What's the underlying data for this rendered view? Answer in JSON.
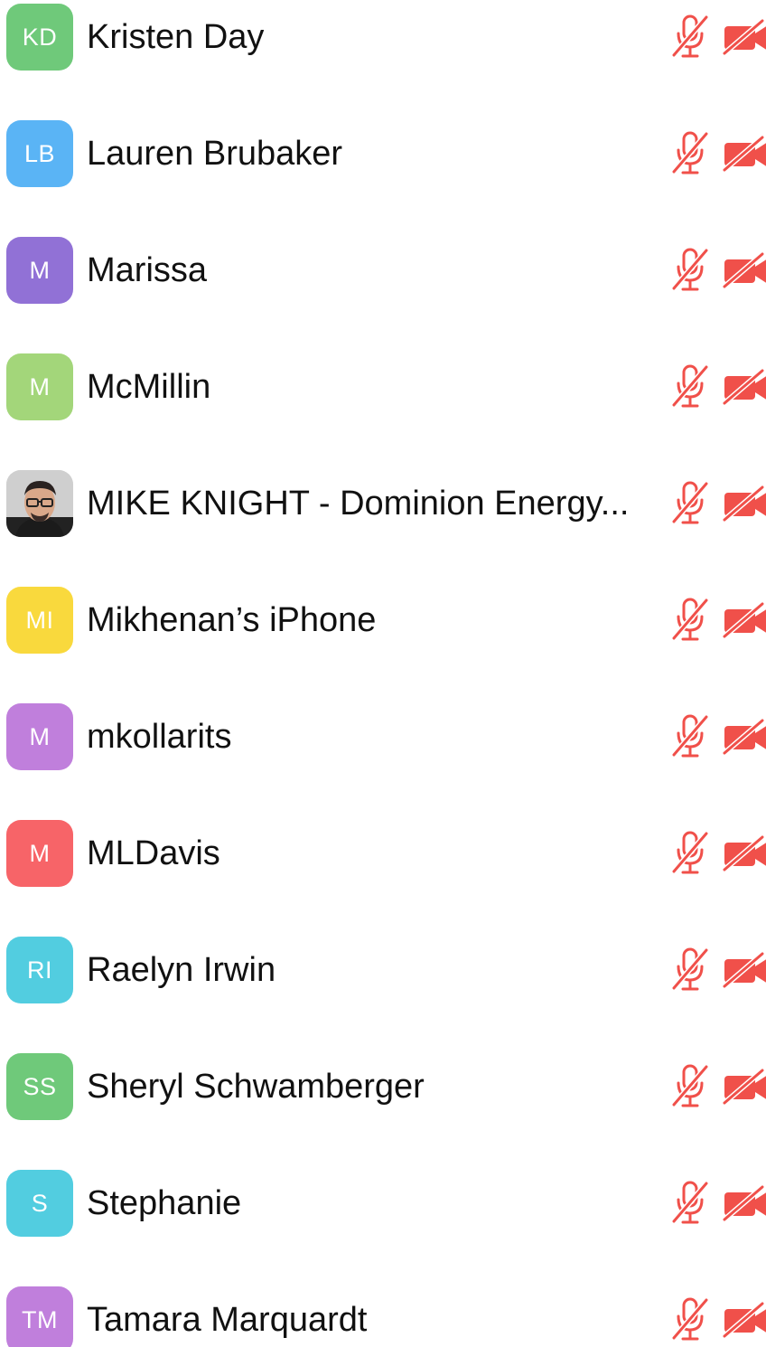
{
  "colors": {
    "muted_red": "#f0504a"
  },
  "participants": [
    {
      "initials": "KD",
      "name": "Kristen Day",
      "avatar_color": "#6fc97a",
      "mic": "mic-muted-icon",
      "camera": "camera-off-icon"
    },
    {
      "initials": "LB",
      "name": "Lauren Brubaker",
      "avatar_color": "#5ab4f5",
      "mic": "mic-muted-icon",
      "camera": "camera-off-icon"
    },
    {
      "initials": "M",
      "name": "Marissa",
      "avatar_color": "#9171d6",
      "mic": "mic-muted-icon",
      "camera": "camera-off-icon"
    },
    {
      "initials": "M",
      "name": "McMillin",
      "avatar_color": "#a3d67a",
      "mic": "mic-muted-icon",
      "camera": "camera-off-icon"
    },
    {
      "initials": "",
      "name": "MIKE KNIGHT - Dominion Energy...",
      "avatar_color": "#d8d8d8",
      "avatar_photo": true,
      "mic": "mic-muted-icon",
      "camera": "camera-off-icon"
    },
    {
      "initials": "MI",
      "name": "Mikhenan’s iPhone",
      "avatar_color": "#f9d93d",
      "mic": "mic-muted-icon",
      "camera": "camera-off-icon"
    },
    {
      "initials": "M",
      "name": "mkollarits",
      "avatar_color": "#c07fdc",
      "mic": "mic-muted-icon",
      "camera": "camera-off-icon"
    },
    {
      "initials": "M",
      "name": "MLDavis",
      "avatar_color": "#f76468",
      "mic": "mic-muted-icon",
      "camera": "camera-off-icon"
    },
    {
      "initials": "RI",
      "name": "Raelyn Irwin",
      "avatar_color": "#52cde0",
      "mic": "mic-muted-icon",
      "camera": "camera-off-icon"
    },
    {
      "initials": "SS",
      "name": "Sheryl Schwamberger",
      "avatar_color": "#6fc97a",
      "mic": "mic-muted-icon",
      "camera": "camera-off-icon"
    },
    {
      "initials": "S",
      "name": "Stephanie",
      "avatar_color": "#52cde0",
      "mic": "mic-muted-icon",
      "camera": "camera-off-icon"
    },
    {
      "initials": "TM",
      "name": "Tamara Marquardt",
      "avatar_color": "#c07fdc",
      "mic": "mic-muted-icon",
      "camera": "camera-off-icon"
    }
  ]
}
